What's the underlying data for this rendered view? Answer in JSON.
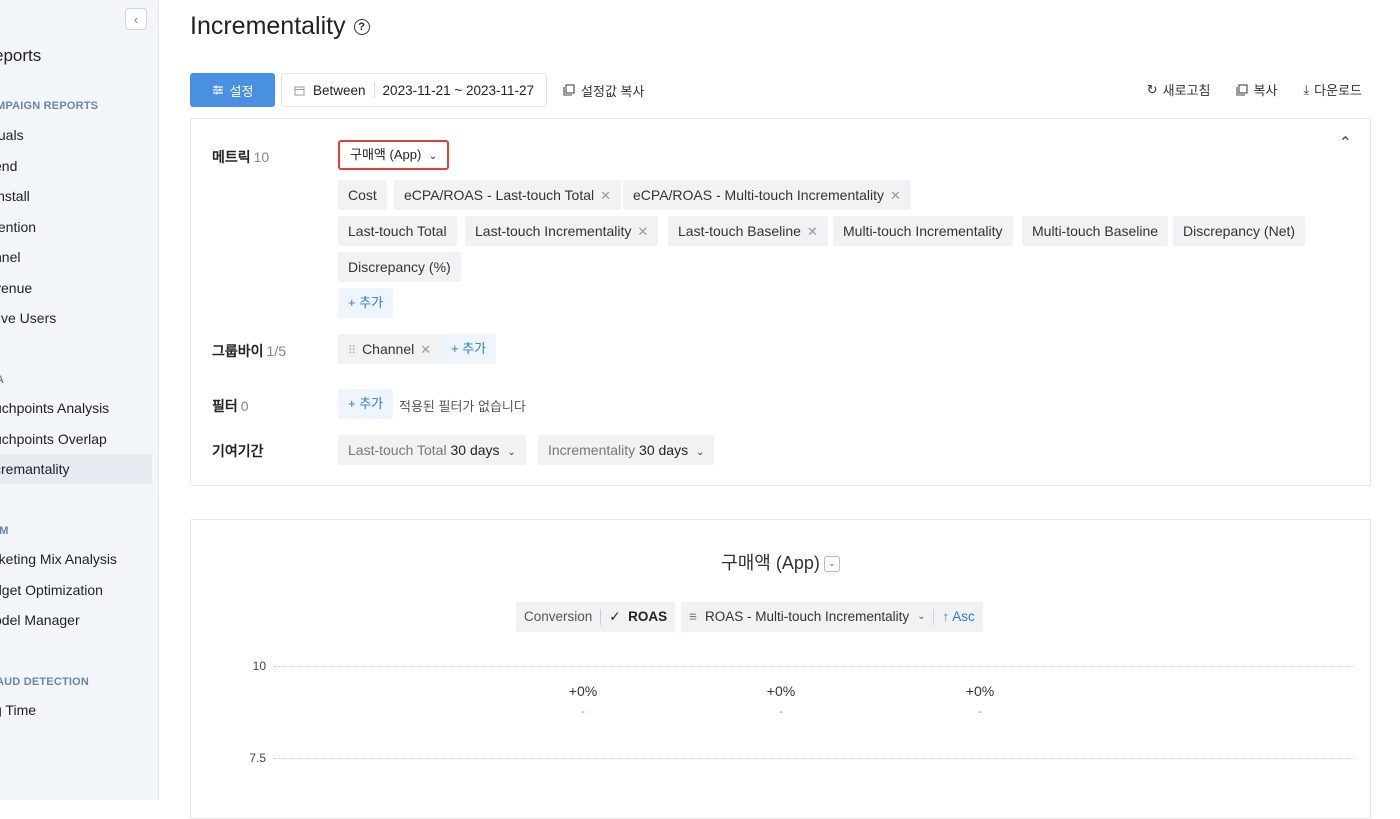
{
  "sidebar": {
    "title": "eports",
    "collapse_icon": "‹",
    "sections": [
      {
        "label": "MPAIGN REPORTS",
        "items": [
          "tuals",
          "end",
          "install",
          "tention",
          "nnel",
          "venue",
          "tive Users"
        ]
      },
      {
        "label": "A",
        "items": [
          "uchpoints Analysis",
          "uchpoints Overlap",
          "cremantality"
        ]
      },
      {
        "label": "IM",
        "items": [
          "rketing Mix Analysis",
          "dget Optimization",
          "odel Manager"
        ]
      },
      {
        "label": "AUD DETECTION",
        "items": [
          "g Time"
        ]
      }
    ],
    "active_item": "cremantality"
  },
  "header": {
    "title": "Incrementality",
    "help_icon": "?"
  },
  "toolbar": {
    "settings_label": "설정",
    "date_prefix": "Between",
    "date_range": "2023-11-21 ~ 2023-11-27",
    "copy_settings_label": "설정값 복사",
    "refresh_label": "새로고침",
    "copy_label": "복사",
    "download_label": "다운로드"
  },
  "config": {
    "metric": {
      "label": "메트릭",
      "count": "10",
      "selected": "구매액 (App)",
      "chips": [
        {
          "text": "Cost",
          "removable": false
        },
        {
          "text": "eCPA/ROAS - Last-touch Total",
          "removable": true
        },
        {
          "text": "eCPA/ROAS - Multi-touch Incrementality",
          "removable": true
        },
        {
          "text": "Last-touch Total",
          "removable": false
        },
        {
          "text": "Last-touch Incrementality",
          "removable": true
        },
        {
          "text": "Last-touch Baseline",
          "removable": true
        },
        {
          "text": "Multi-touch Incrementality",
          "removable": false
        },
        {
          "text": "Multi-touch Baseline",
          "removable": false
        },
        {
          "text": "Discrepancy (Net)",
          "removable": false
        },
        {
          "text": "Discrepancy (%)",
          "removable": false
        }
      ],
      "add_label": "+ 추가"
    },
    "groupby": {
      "label": "그룹바이",
      "count": "1/5",
      "chip": "Channel",
      "add_label": "+ 추가"
    },
    "filter": {
      "label": "필터",
      "count": "0",
      "add_label": "+ 추가",
      "empty_text": "적용된 필터가 없습니다"
    },
    "attribution": {
      "label": "기여기간",
      "lt_label": "Last-touch Total",
      "lt_value": "30 days",
      "inc_label": "Incrementality",
      "inc_value": "30 days"
    }
  },
  "chart": {
    "title": "구매액 (App)",
    "conversion_label": "Conversion",
    "roas_label": "ROAS",
    "sort_label": "ROAS - Multi-touch Incrementality",
    "asc_label": "↑ Asc"
  },
  "chart_data": {
    "type": "bar",
    "yticks": [
      "10",
      "7.5"
    ],
    "data_labels": [
      {
        "value": "+0%",
        "sub": "-"
      },
      {
        "value": "+0%",
        "sub": "-"
      },
      {
        "value": "+0%",
        "sub": "-"
      }
    ]
  }
}
